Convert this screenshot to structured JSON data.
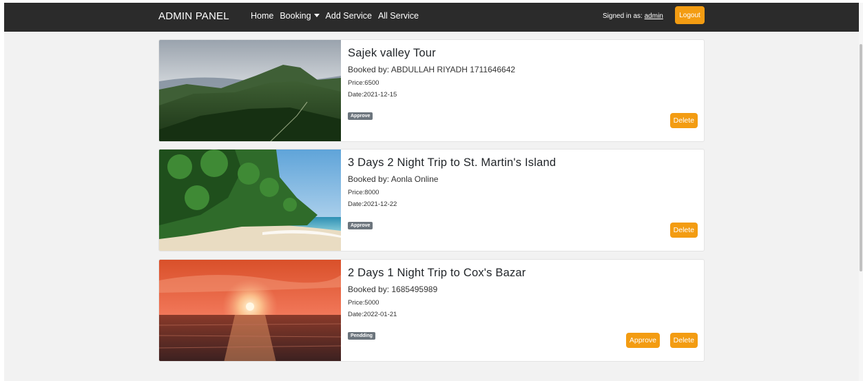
{
  "navbar": {
    "brand": "ADMIN PANEL",
    "links": {
      "home": "Home",
      "booking": "Booking",
      "add_service": "Add Service",
      "all_service": "All Service"
    },
    "signed_in_prefix": "Signed in as:",
    "username": "admin",
    "logout_label": "Logout"
  },
  "colors": {
    "navbar_bg": "#2b2b2b",
    "accent": "#f39c12",
    "badge_bg": "#6c757d",
    "page_bg": "#f2f2f2"
  },
  "bookings": [
    {
      "title": "Sajek valley Tour",
      "booked_by": "Booked by: ABDULLAH RIYADH 1711646642",
      "price": "Price:6500",
      "date": "Date:2021-12-15",
      "status": "Approve",
      "image": "mountain-valley",
      "delete_label": "Delete"
    },
    {
      "title": "3 Days 2 Night Trip to St. Martin's Island",
      "booked_by": "Booked by: Aonla Online",
      "price": "Price:8000",
      "date": "Date:2021-12-22",
      "status": "Approve",
      "image": "palm-beach",
      "delete_label": "Delete"
    },
    {
      "title": "2 Days 1 Night Trip to Cox's Bazar",
      "booked_by": "Booked by: 1685495989",
      "price": "Price:5000",
      "date": "Date:2022-01-21",
      "status": "Pendding",
      "image": "sunset-sea",
      "approve_label": "Approve",
      "delete_label": "Delete"
    }
  ]
}
